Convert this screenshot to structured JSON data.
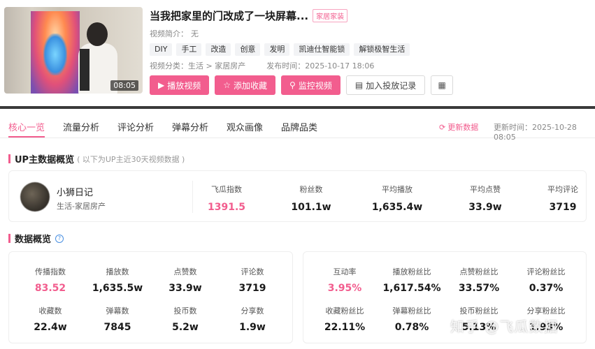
{
  "video": {
    "duration": "08:05",
    "title": "当我把家里的门改成了一块屏幕...",
    "category_badge": "家居家装",
    "intro_label": "视频简介：",
    "intro_value": "无",
    "tags": [
      "DIY",
      "手工",
      "改造",
      "创意",
      "发明",
      "凯迪仕智能锁",
      "解锁极智生活"
    ],
    "category_label": "视频分类：",
    "category_value": "生活 > 家居房产",
    "publish_label": "发布时间：",
    "publish_value": "2025-10-17 18:06"
  },
  "actions": {
    "play": "播放视频",
    "favorite": "添加收藏",
    "monitor": "监控视频",
    "add_record": "加入投放记录"
  },
  "tabs": [
    {
      "label": "核心一览"
    },
    {
      "label": "流量分析"
    },
    {
      "label": "评论分析"
    },
    {
      "label": "弹幕分析"
    },
    {
      "label": "观众画像"
    },
    {
      "label": "品牌品类"
    }
  ],
  "toolbar": {
    "refresh": "更新数据",
    "update_time": "更新时间：2025-10-28 08:05"
  },
  "up_section": {
    "title": "UP主数据概览",
    "subtitle": "( 以下为UP主近30天视频数据 )",
    "name": "小狮日记",
    "category": "生活-家居房产",
    "stats": [
      {
        "label": "飞瓜指数",
        "value": "1391.5"
      },
      {
        "label": "粉丝数",
        "value": "101.1w"
      },
      {
        "label": "平均播放",
        "value": "1,635.4w"
      },
      {
        "label": "平均点赞",
        "value": "33.9w"
      },
      {
        "label": "平均评论",
        "value": "3719"
      }
    ]
  },
  "data_section": {
    "title": "数据概览",
    "left": [
      {
        "label": "传播指数",
        "value": "83.52"
      },
      {
        "label": "播放数",
        "value": "1,635.5w"
      },
      {
        "label": "点赞数",
        "value": "33.9w"
      },
      {
        "label": "评论数",
        "value": "3719"
      },
      {
        "label": "收藏数",
        "value": "22.4w"
      },
      {
        "label": "弹幕数",
        "value": "7845"
      },
      {
        "label": "投币数",
        "value": "5.2w"
      },
      {
        "label": "分享数",
        "value": "1.9w"
      }
    ],
    "right": [
      {
        "label": "互动率",
        "value": "3.95%"
      },
      {
        "label": "播放粉丝比",
        "value": "1,617.54%"
      },
      {
        "label": "点赞粉丝比",
        "value": "33.57%"
      },
      {
        "label": "评论粉丝比",
        "value": "0.37%"
      },
      {
        "label": "收藏粉丝比",
        "value": "22.11%"
      },
      {
        "label": "弹幕粉丝比",
        "value": "0.78%"
      },
      {
        "label": "投币粉丝比",
        "value": "5.13%"
      },
      {
        "label": "分享粉丝比",
        "value": "1.93%"
      }
    ]
  },
  "watermark": "知乎 @飞瓜数据",
  "colors": {
    "accent": "#f25d8e"
  }
}
